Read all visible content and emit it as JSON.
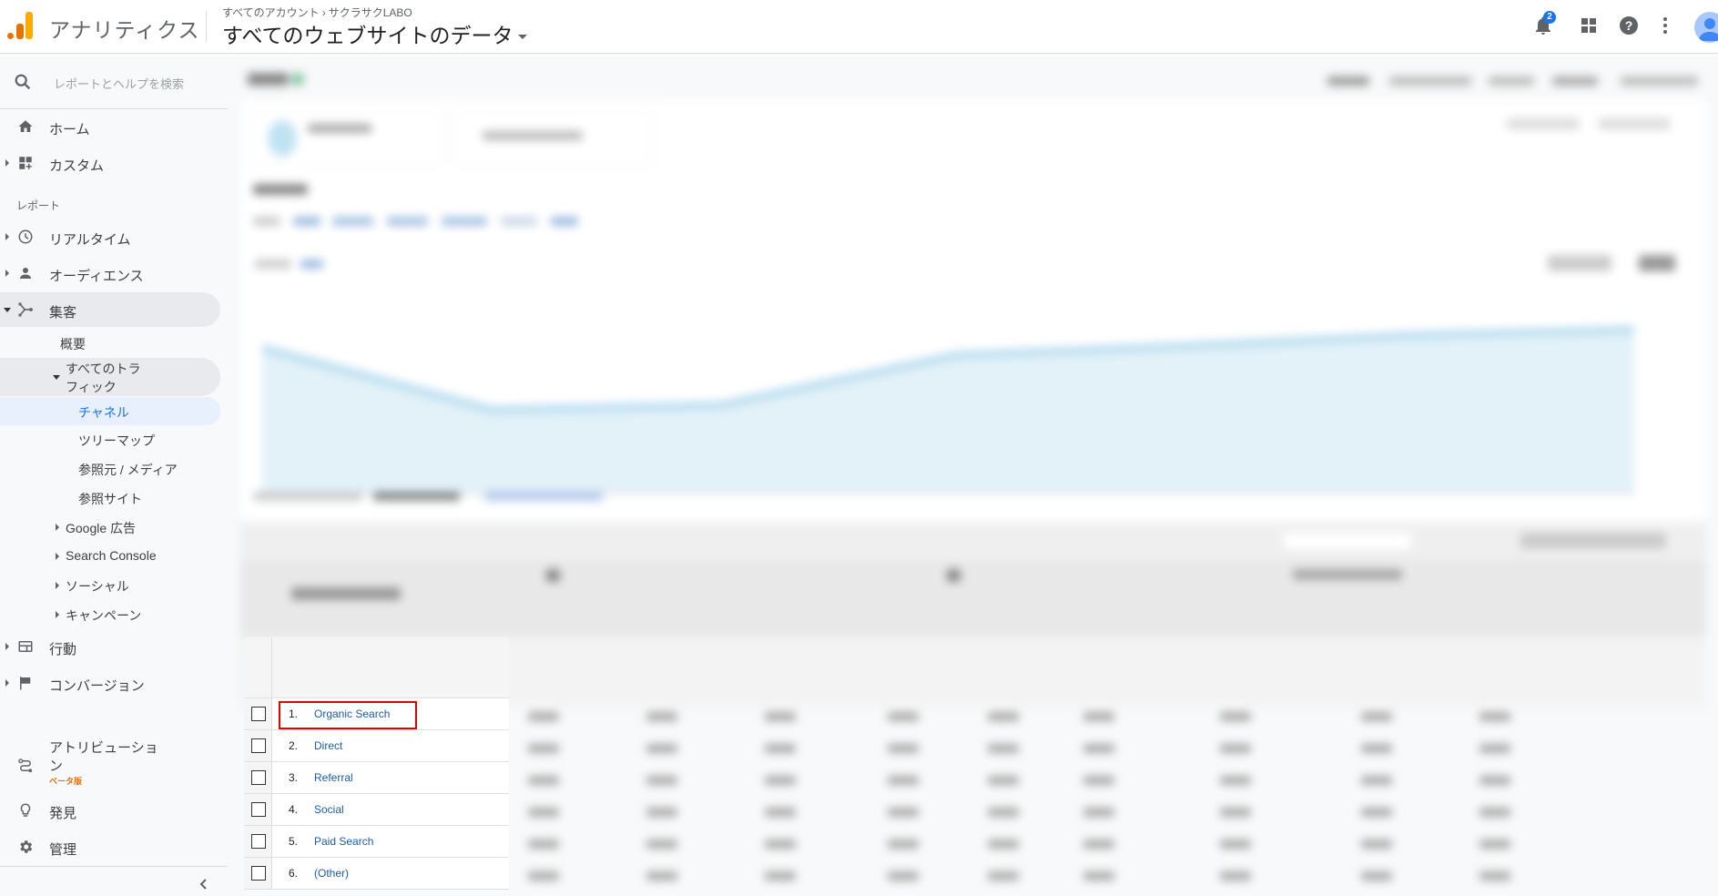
{
  "header": {
    "app_title": "アナリティクス",
    "breadcrumb": {
      "account": "すべてのアカウント",
      "separator": "›",
      "property": "サクラサクLABO"
    },
    "view": "すべてのウェブサイトのデータ",
    "notifications_count": "2",
    "icons": [
      "bell-icon",
      "apps-icon",
      "help-icon",
      "more-vert-icon",
      "account-avatar"
    ]
  },
  "sidebar": {
    "search_placeholder": "レポートとヘルプを検索",
    "top_items": [
      {
        "label": "ホーム",
        "icon": "home-icon"
      },
      {
        "label": "カスタム",
        "icon": "dashboard-icon"
      }
    ],
    "reports_label": "レポート",
    "report_items": [
      {
        "label": "リアルタイム",
        "icon": "clock-icon"
      },
      {
        "label": "オーディエンス",
        "icon": "person-icon"
      },
      {
        "label": "集客",
        "icon": "acquisition-icon",
        "expanded": true
      }
    ],
    "acquisition_sub": {
      "overview": "概要",
      "all_traffic": "すべてのトラフィック",
      "all_traffic_line1": "すべてのトラ",
      "all_traffic_line2": "フィック",
      "all_traffic_children": [
        "チャネル",
        "ツリーマップ",
        "参照元 / メディア",
        "参照サイト"
      ],
      "selected": "チャネル",
      "collapsed_groups": [
        "Google 広告",
        "Search Console",
        "ソーシャル",
        "キャンペーン"
      ]
    },
    "lower_items": [
      {
        "label": "行動",
        "icon": "behavior-icon"
      },
      {
        "label": "コンバージョン",
        "icon": "flag-icon"
      }
    ],
    "attribution": {
      "label_line1": "アトリビューショ",
      "label_line2": "ン",
      "badge": "ベータ版"
    },
    "discover": "発見",
    "admin": "管理"
  },
  "table": {
    "rows": [
      {
        "index": "1.",
        "channel": "Organic Search",
        "highlighted": true
      },
      {
        "index": "2.",
        "channel": "Direct"
      },
      {
        "index": "3.",
        "channel": "Referral"
      },
      {
        "index": "4.",
        "channel": "Social"
      },
      {
        "index": "5.",
        "channel": "Paid Search"
      },
      {
        "index": "6.",
        "channel": "(Other)"
      }
    ]
  },
  "colors": {
    "accent_blue": "#1a73e8",
    "link_blue": "#1f5ca6",
    "highlight_red": "#e50000",
    "beta_orange": "#e8710a",
    "logo_orange": "#e37400",
    "logo_yellow": "#f9ab00"
  }
}
